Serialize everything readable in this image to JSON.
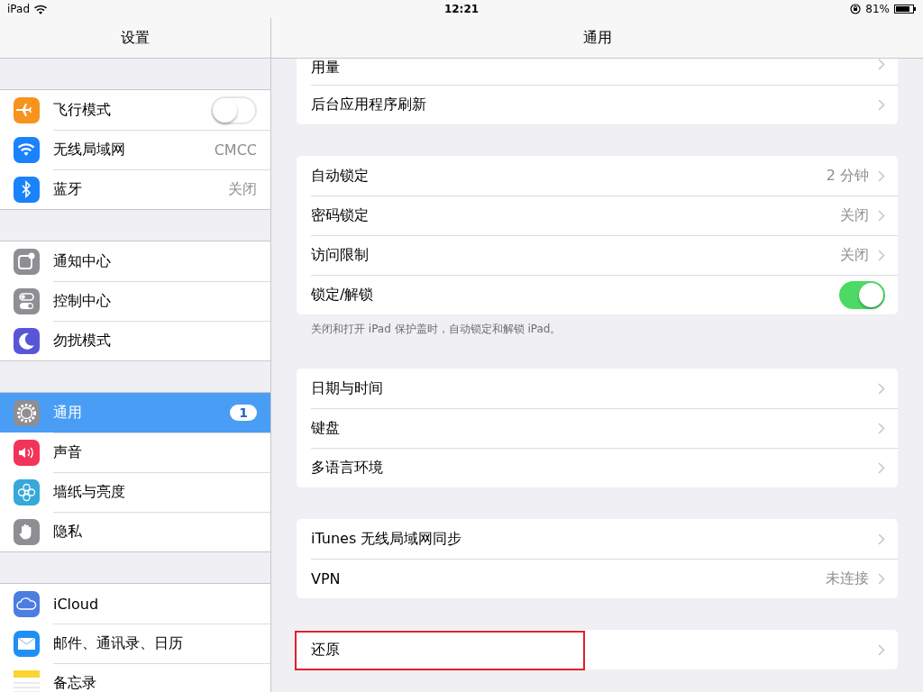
{
  "status_bar": {
    "device": "iPad",
    "time": "12:21",
    "battery": "81%"
  },
  "sidebar": {
    "title": "设置",
    "groups": [
      [
        {
          "label": "飞行模式",
          "kind": "toggle",
          "on": false,
          "color": "#f7941d",
          "selected": false
        },
        {
          "label": "无线局域网",
          "kind": "value",
          "value": "CMCC",
          "color": "#1a82fb",
          "selected": false
        },
        {
          "label": "蓝牙",
          "kind": "value",
          "value": "关闭",
          "color": "#1a82fb",
          "selected": false
        }
      ],
      [
        {
          "label": "通知中心",
          "kind": "plain",
          "color": "#8e8e93",
          "selected": false
        },
        {
          "label": "控制中心",
          "kind": "plain",
          "color": "#8e8e93",
          "selected": false
        },
        {
          "label": "勿扰模式",
          "kind": "plain",
          "color": "#5856d6",
          "selected": false
        }
      ],
      [
        {
          "label": "通用",
          "kind": "badge",
          "badge": "1",
          "color": "#8e8e93",
          "selected": true
        },
        {
          "label": "声音",
          "kind": "plain",
          "color": "#f2335a",
          "selected": false
        },
        {
          "label": "墙纸与亮度",
          "kind": "plain",
          "color": "#36a8d9",
          "selected": false
        },
        {
          "label": "隐私",
          "kind": "plain",
          "color": "#8e8e93",
          "selected": false
        }
      ],
      [
        {
          "label": "iCloud",
          "kind": "plain",
          "color": "#4c7de0",
          "selected": false
        },
        {
          "label": "邮件、通讯录、日历",
          "kind": "plain",
          "color": "#1e90f5",
          "selected": false
        },
        {
          "label": "备忘录",
          "kind": "plain",
          "color": "#fbd431",
          "selected": false
        }
      ]
    ]
  },
  "detail": {
    "title": "通用",
    "groups": [
      {
        "rows": [
          {
            "label": "用量",
            "kind": "link"
          },
          {
            "label": "后台应用程序刷新",
            "kind": "link"
          }
        ]
      },
      {
        "rows": [
          {
            "label": "自动锁定",
            "kind": "link",
            "value": "2 分钟"
          },
          {
            "label": "密码锁定",
            "kind": "link",
            "value": "关闭"
          },
          {
            "label": "访问限制",
            "kind": "link",
            "value": "关闭"
          },
          {
            "label": "锁定/解锁",
            "kind": "toggle",
            "on": true
          }
        ],
        "footer": "关闭和打开 iPad 保护盖时，自动锁定和解锁 iPad。"
      },
      {
        "rows": [
          {
            "label": "日期与时间",
            "kind": "link"
          },
          {
            "label": "键盘",
            "kind": "link"
          },
          {
            "label": "多语言环境",
            "kind": "link"
          }
        ]
      },
      {
        "rows": [
          {
            "label": "iTunes 无线局域网同步",
            "kind": "link"
          },
          {
            "label": "VPN",
            "kind": "link",
            "value": "未连接"
          }
        ]
      },
      {
        "rows": [
          {
            "label": "还原",
            "kind": "link",
            "highlighted": true
          }
        ]
      }
    ]
  }
}
